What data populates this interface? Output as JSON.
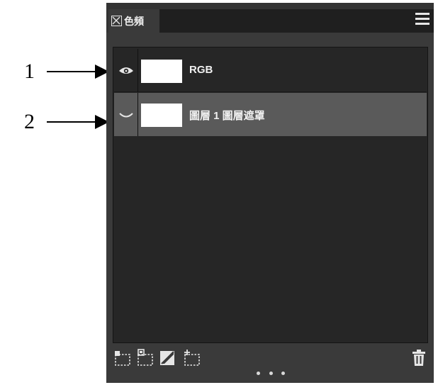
{
  "callouts": [
    {
      "number": "1"
    },
    {
      "number": "2"
    }
  ],
  "panel": {
    "tab_title": "色頻",
    "menu_icon": "hamburger-menu-icon",
    "close_icon": "tab-close-icon"
  },
  "channels": [
    {
      "name": "RGB",
      "visible": true,
      "selected": false,
      "visibility_icon": "eye-icon"
    },
    {
      "name": "圖層 1 圖層遮罩",
      "visible": false,
      "selected": true,
      "visibility_icon": "eye-closed-icon"
    }
  ],
  "footer": {
    "icons": [
      "load-channel-as-selection-icon",
      "save-selection-as-channel-icon",
      "channel-mask-icon",
      "new-channel-icon",
      "trash-icon"
    ],
    "more_icon": "more-dots-icon"
  },
  "colors": {
    "panel_bg": "#3a3a3a",
    "list_bg": "#262626",
    "selected_row": "#5a5a5a",
    "text": "#f0f0f0"
  }
}
